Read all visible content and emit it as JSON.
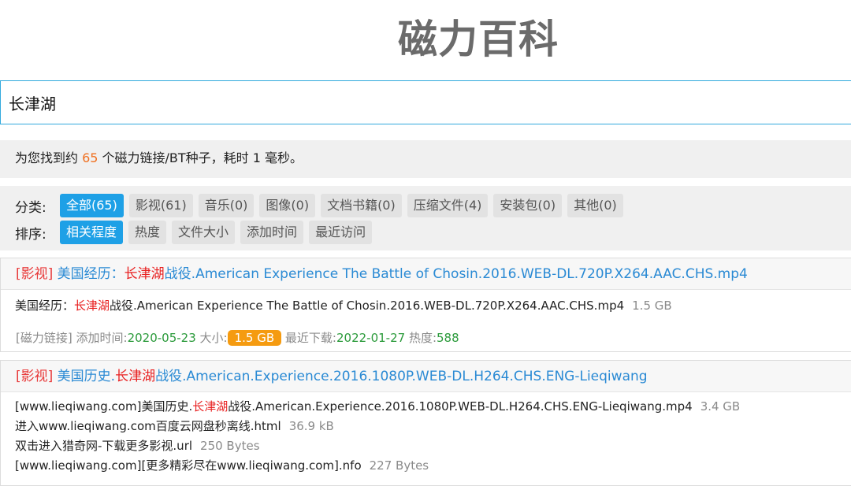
{
  "site": {
    "title": "磁力百科"
  },
  "search": {
    "value": "长津湖"
  },
  "summary": {
    "prefix": "为您找到约 ",
    "count": "65",
    "suffix": " 个磁力链接/BT种子，耗时 1 毫秒。"
  },
  "filters": {
    "category_label": "分类:",
    "categories": [
      "全部(65)",
      "影视(61)",
      "音乐(0)",
      "图像(0)",
      "文档书籍(0)",
      "压缩文件(4)",
      "安装包(0)",
      "其他(0)"
    ],
    "sort_label": "排序:",
    "sorts": [
      "相关程度",
      "热度",
      "文件大小",
      "添加时间",
      "最近访问"
    ]
  },
  "results": [
    {
      "category": "[影视]",
      "title_pre": " 美国经历：",
      "title_hl": "长津湖",
      "title_post": "战役.American Experience The Battle of Chosin.2016.WEB-DL.720P.X264.AAC.CHS.mp4",
      "files": [
        {
          "pre": "美国经历：",
          "hl": "长津湖",
          "post": "战役.American Experience The Battle of Chosin.2016.WEB-DL.720P.X264.AAC.CHS.mp4",
          "size": "1.5 GB"
        }
      ],
      "meta": {
        "magnet_label": "[磁力链接]",
        "added_label": "添加时间:",
        "added": "2020-05-23",
        "size_label": "大小:",
        "size": "1.5 GB",
        "recent_label": "最近下载:",
        "recent": "2022-01-27",
        "heat_label": "热度:",
        "heat": "588"
      }
    },
    {
      "category": "[影视]",
      "title_pre": " 美国历史.",
      "title_hl": "长津湖",
      "title_post": "战役.American.Experience.2016.1080P.WEB-DL.H264.CHS.ENG-Lieqiwang",
      "files": [
        {
          "pre": "[www.lieqiwang.com]美国历史.",
          "hl": "长津湖",
          "post": "战役.American.Experience.2016.1080P.WEB-DL.H264.CHS.ENG-Lieqiwang.mp4",
          "size": "3.4 GB"
        },
        {
          "pre": "进入www.lieqiwang.com百度云网盘秒离线.html",
          "hl": "",
          "post": "",
          "size": "36.9 kB"
        },
        {
          "pre": "双击进入猎奇网-下载更多影视.url",
          "hl": "",
          "post": "",
          "size": "250 Bytes"
        },
        {
          "pre": "[www.lieqiwang.com][更多精彩尽在www.lieqiwang.com].nfo",
          "hl": "",
          "post": "",
          "size": "227 Bytes"
        }
      ]
    }
  ]
}
